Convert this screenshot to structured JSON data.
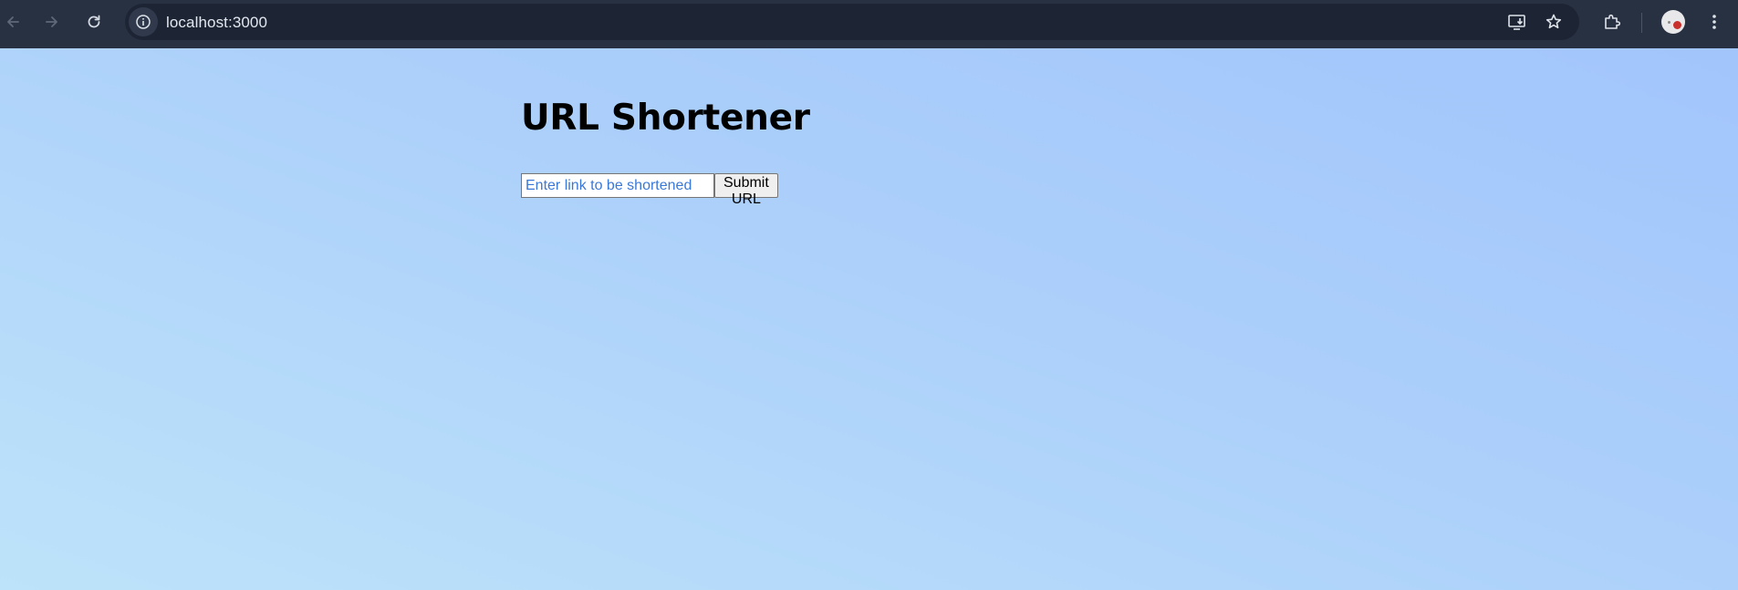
{
  "browser": {
    "address": "localhost:3000",
    "icons": {
      "back": "back-arrow-icon",
      "forward": "forward-arrow-icon",
      "reload": "reload-icon",
      "site_info": "info-icon",
      "install": "install-app-icon",
      "bookmark": "star-icon",
      "extensions": "puzzle-icon",
      "profile": "avatar",
      "menu": "kebab-menu-icon"
    },
    "colors": {
      "toolbar": "#283142",
      "omnibox": "#1d2535"
    }
  },
  "page": {
    "title": "URL Shortener",
    "input_placeholder": "Enter link to be shortened",
    "input_value": "",
    "submit_label": "Submit URL",
    "colors": {
      "gradient_start": "#a2c5fc",
      "gradient_end": "#bde3fa",
      "placeholder": "#3a78d8"
    }
  }
}
